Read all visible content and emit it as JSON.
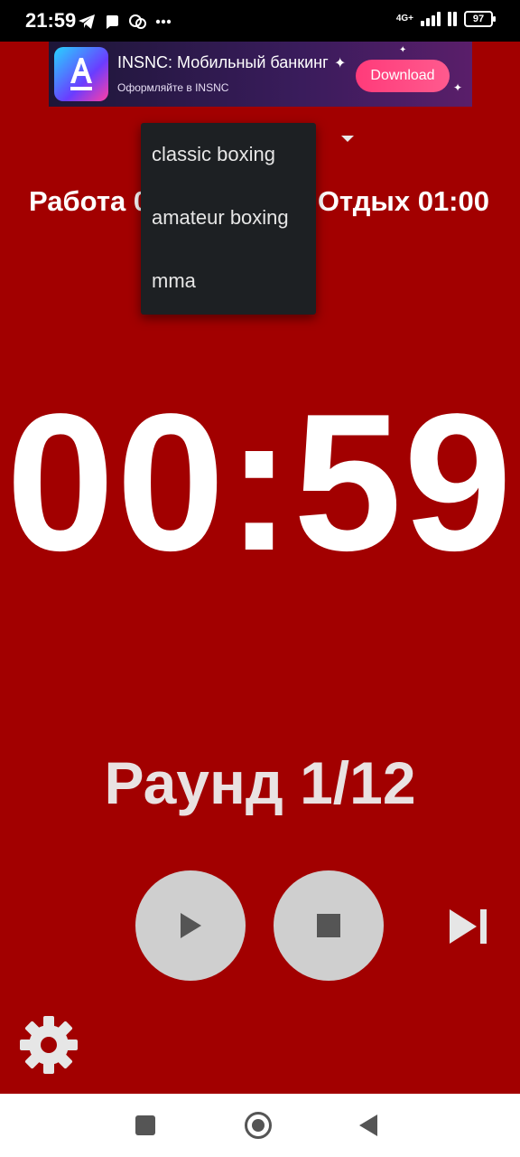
{
  "status_bar": {
    "time": "21:59",
    "network": "4G+",
    "battery": "97",
    "icons": [
      "telegram-icon",
      "notification-icon",
      "chat-icon",
      "more-dots-icon",
      "signal-icon",
      "battery-icon"
    ]
  },
  "ad": {
    "title": "INSNC: Мобильный банкинг",
    "subtitle": "Оформляйте в INSNC",
    "button": "Download",
    "logo_letter": "A"
  },
  "header": {
    "work": "Работа 0",
    "rest": "Отдых 01:00"
  },
  "menu": {
    "items": [
      "classic boxing",
      "amateur boxing",
      "mma"
    ]
  },
  "timer": {
    "value": "00:59"
  },
  "round": {
    "label": "Раунд 1/12"
  },
  "controls": {
    "icons": [
      "play-icon",
      "stop-icon",
      "skip-next-icon",
      "settings-gear-icon"
    ]
  },
  "colors": {
    "background": "#a20000",
    "button": "#cfcfcf",
    "menu": "#1d2023"
  }
}
